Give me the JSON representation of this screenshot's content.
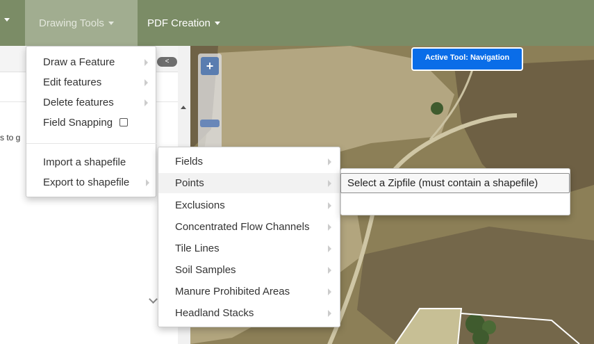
{
  "navbar": {
    "items": [
      {
        "label": "Drawing Tools"
      },
      {
        "label": "PDF Creation"
      }
    ]
  },
  "left_panel": {
    "collapse_glyph": "<",
    "snippet": "s to g"
  },
  "map": {
    "zoom_in_label": "+",
    "active_tool": "Active Tool: Navigation"
  },
  "drawing_menu": {
    "items": [
      {
        "label": "Draw a Feature"
      },
      {
        "label": "Edit features"
      },
      {
        "label": "Delete features"
      },
      {
        "label": "Field Snapping"
      },
      {
        "label": "Import a shapefile"
      },
      {
        "label": "Export to shapefile"
      }
    ],
    "field_snapping_checked": false
  },
  "import_menu": {
    "items": [
      {
        "label": "Fields"
      },
      {
        "label": "Points"
      },
      {
        "label": "Exclusions"
      },
      {
        "label": "Concentrated Flow Channels"
      },
      {
        "label": "Tile Lines"
      },
      {
        "label": "Soil Samples"
      },
      {
        "label": "Manure Prohibited Areas"
      },
      {
        "label": "Headland Stacks"
      }
    ],
    "highlighted": "Points"
  },
  "zip_menu": {
    "button_label": "Select a Zipfile (must contain a shapefile)"
  },
  "colors": {
    "navbar": "#7b8c66",
    "active_tool": "#0a6de8"
  }
}
